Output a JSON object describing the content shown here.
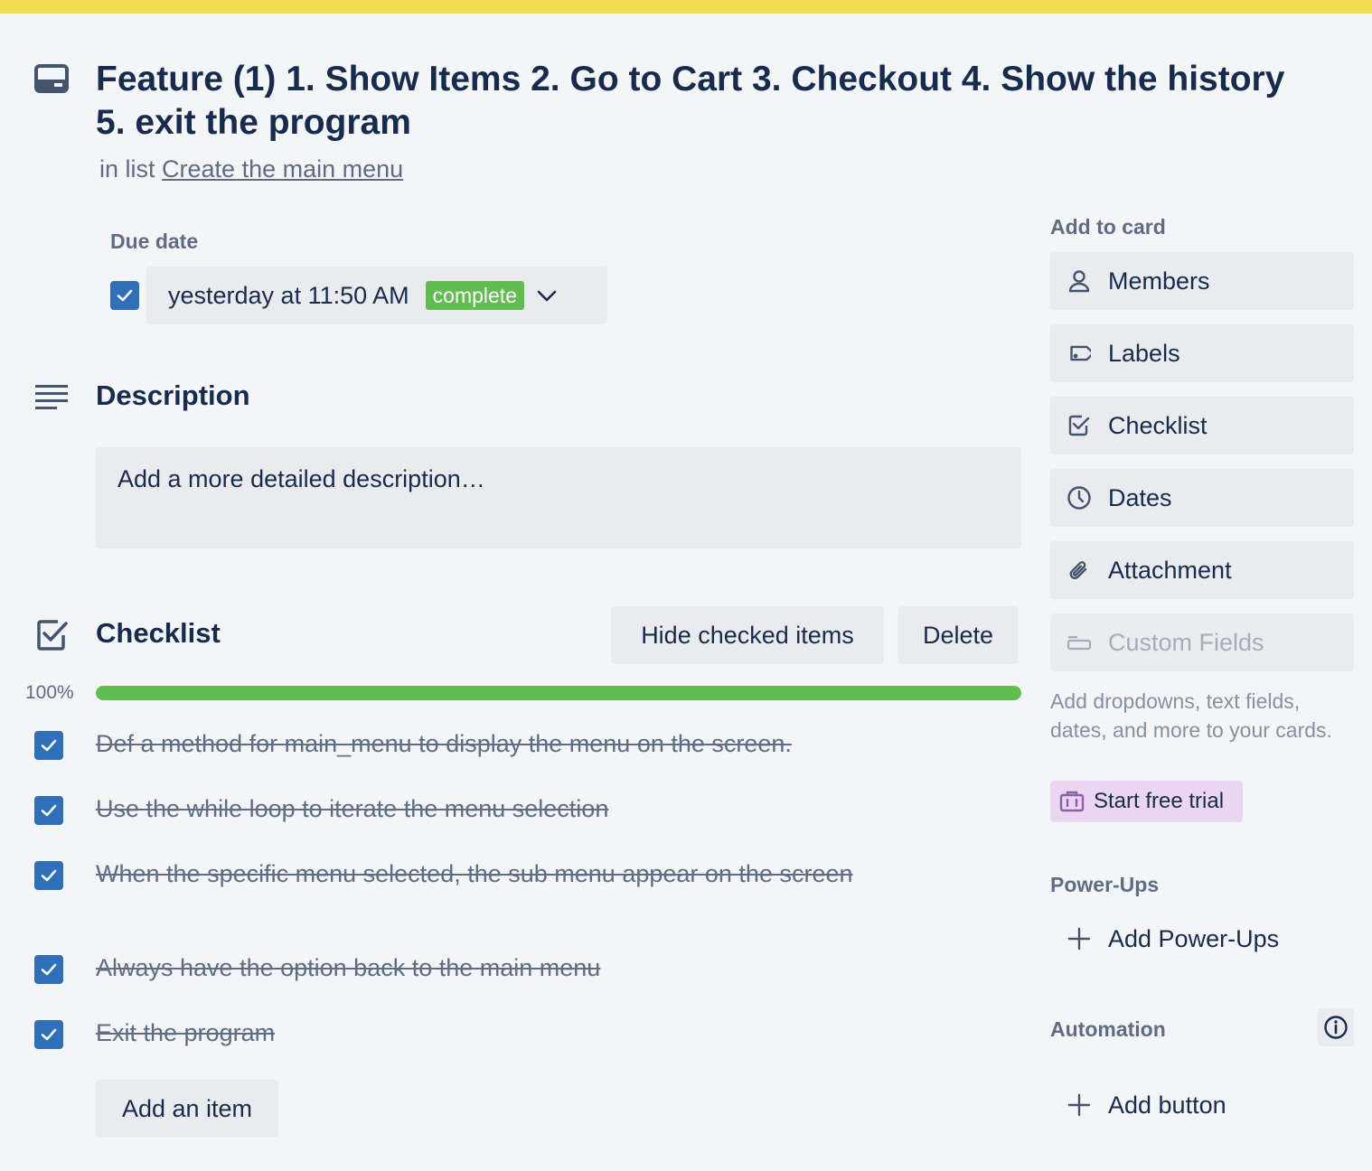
{
  "card": {
    "title": "Feature (1) 1. Show Items 2. Go to Cart 3. Checkout 4. Show the history 5. exit the program",
    "in_list_prefix": "in list",
    "list_name": "Create the main menu"
  },
  "due": {
    "label": "Due date",
    "checked": true,
    "value": "yesterday at 11:50 AM",
    "badge": "complete"
  },
  "description": {
    "title": "Description",
    "placeholder": "Add a more detailed description…"
  },
  "checklist": {
    "title": "Checklist",
    "hide_label": "Hide checked items",
    "delete_label": "Delete",
    "percent_text": "100%",
    "progress": 1.0,
    "items": [
      {
        "text": "Def a method for main_menu to display the menu on the screen.",
        "checked": true
      },
      {
        "text": "Use the while loop to iterate the menu selection",
        "checked": true
      },
      {
        "text": "When the specific menu selected, the sub menu appear on the screen",
        "checked": true
      },
      {
        "text": "Always have the option back to the main menu",
        "checked": true
      },
      {
        "text": "Exit the program",
        "checked": true
      }
    ],
    "add_item_label": "Add an item"
  },
  "sidebar": {
    "add_to_card_title": "Add to card",
    "buttons": [
      {
        "label": "Members",
        "icon": "person-icon"
      },
      {
        "label": "Labels",
        "icon": "tag-icon"
      },
      {
        "label": "Checklist",
        "icon": "checklist-icon"
      },
      {
        "label": "Dates",
        "icon": "clock-icon"
      },
      {
        "label": "Attachment",
        "icon": "paperclip-icon"
      },
      {
        "label": "Custom Fields",
        "icon": "field-icon",
        "disabled": true
      }
    ],
    "custom_fields_note": "Add dropdowns, text fields, dates, and more to your cards.",
    "trial_label": "Start free trial",
    "powerups_title": "Power-Ups",
    "add_powerups_label": "Add Power-Ups",
    "automation_title": "Automation",
    "add_button_label": "Add button"
  },
  "colors": {
    "top_bar": "#f2dd52",
    "checkbox": "#2f6fb8",
    "complete_badge": "#61bd4f",
    "progress": "#61bd4f",
    "trial_bg": "#ead6f0"
  }
}
